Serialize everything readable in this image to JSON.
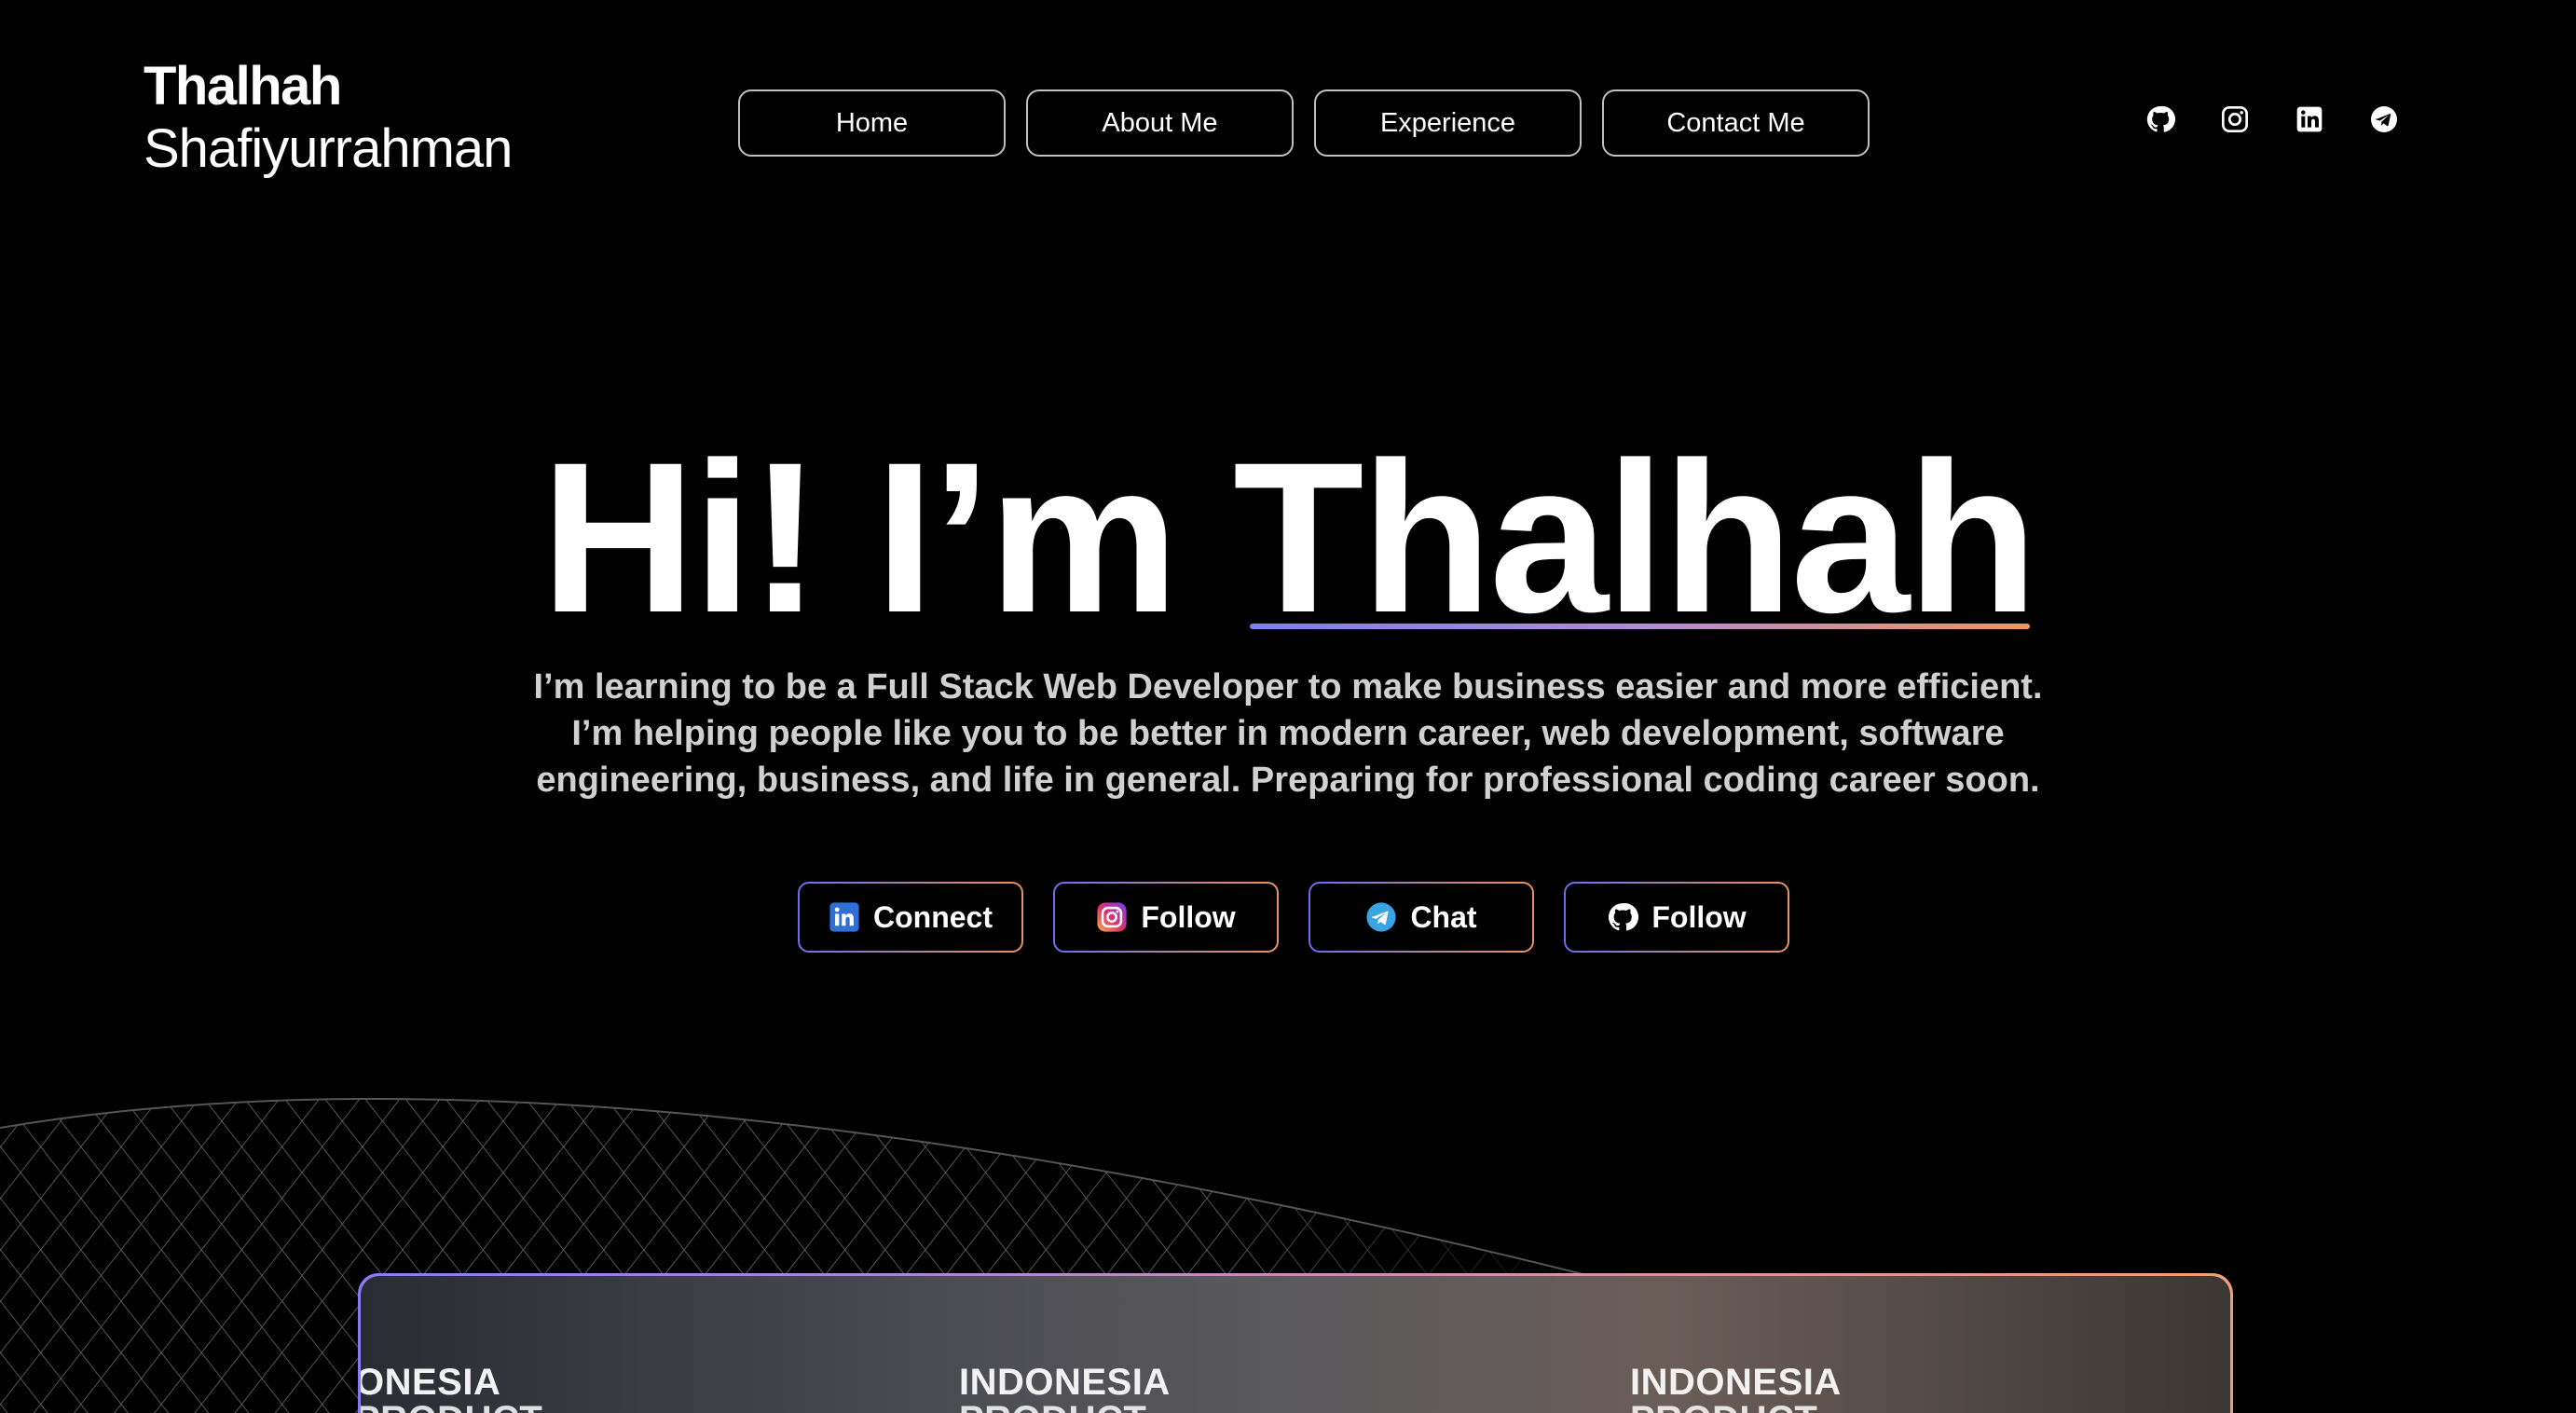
{
  "header": {
    "logo_first": "Thalhah",
    "logo_last": "Shafiyurrahman",
    "nav": [
      "Home",
      "About Me",
      "Experience",
      "Contact Me"
    ],
    "social_icons": [
      "github-icon",
      "instagram-icon",
      "linkedin-icon",
      "telegram-icon"
    ]
  },
  "hero": {
    "title_prefix": "Hi! I’m",
    "title_name": "Thalhah",
    "description": [
      "I’m learning to be a Full Stack Web Developer to make business easier and more efficient.",
      "I’m helping people like you to be better in modern career, web development, software",
      "engineering, business, and life in general. Preparing for professional coding career soon."
    ],
    "cta": [
      {
        "label": "Connect",
        "icon": "linkedin-icon"
      },
      {
        "label": "Follow",
        "icon": "instagram-icon"
      },
      {
        "label": "Chat",
        "icon": "telegram-icon"
      },
      {
        "label": "Follow",
        "icon": "github-icon"
      }
    ]
  },
  "preview": {
    "banners": [
      {
        "line1": "ONESIA",
        "line2": "PRODUCT"
      },
      {
        "line1": "INDONESIA",
        "line2": "PRODUCT"
      },
      {
        "line1": "INDONESIA",
        "line2": "PRODUCT"
      }
    ]
  },
  "colors": {
    "background": "#000000",
    "accent_start": "#7b7ff0",
    "accent_end": "#f0955a",
    "nav_border": "#bfbfbf",
    "desc_text": "#d0d0d0"
  }
}
